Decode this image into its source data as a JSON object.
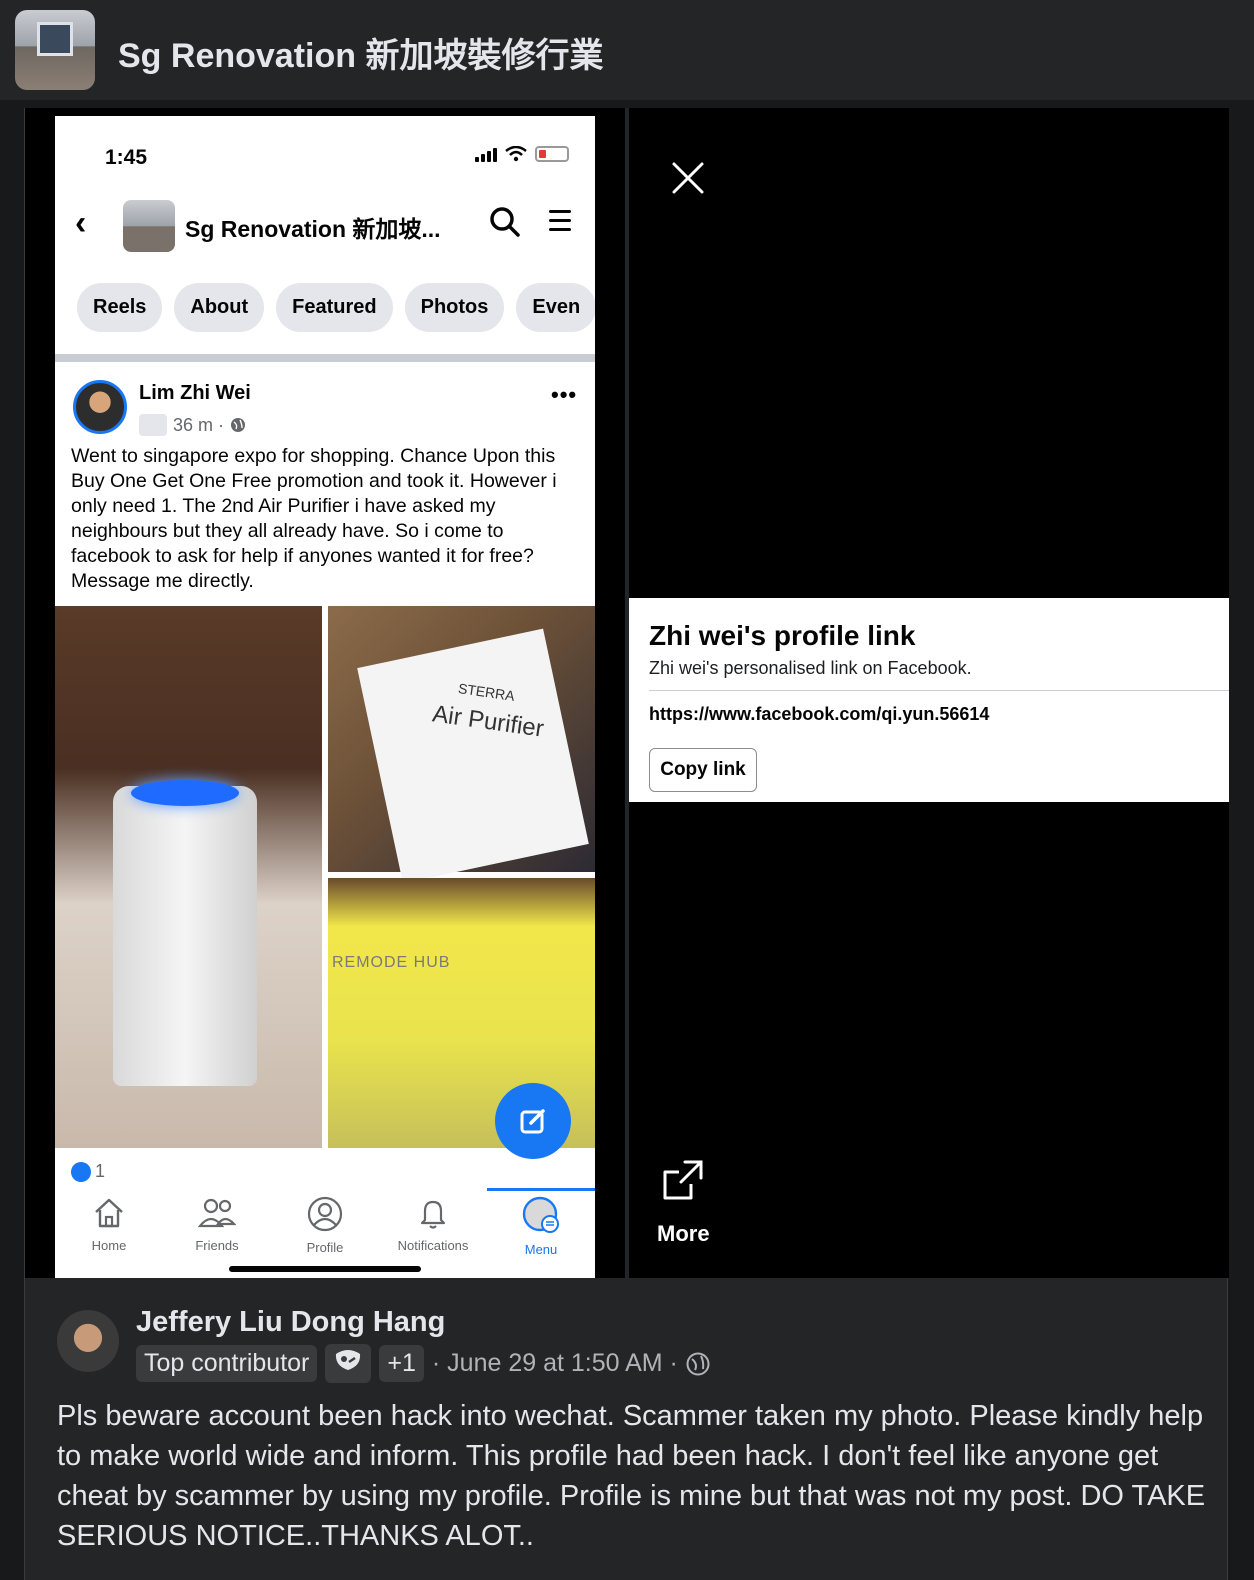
{
  "group": {
    "title": "Sg Renovation 新加坡裝修行業"
  },
  "phone": {
    "status_time": "1:45",
    "nav_title": "Sg Renovation 新加坡...",
    "chips": [
      "Reels",
      "About",
      "Featured",
      "Photos",
      "Even"
    ],
    "post": {
      "author": "Lim Zhi Wei",
      "time": "36 m ·",
      "text": "Went to singapore expo for shopping. Chance Upon this Buy One Get One Free promotion and took it. However i only need 1. The 2nd Air Purifier i have asked my neighbours but they all already have. So i come to facebook to ask for help if anyones wanted it for free? Message me directly.",
      "photo_texts": {
        "brand": "STERRA",
        "product": "Air Purifier",
        "store": "REMODE HUB"
      },
      "likes": "1"
    },
    "tabs": [
      "Home",
      "Friends",
      "Profile",
      "Notifications",
      "Menu"
    ],
    "active_tab": "Menu"
  },
  "profile_link": {
    "title": "Zhi wei's profile link",
    "subtitle": "Zhi wei's personalised link on Facebook.",
    "url": "https://www.facebook.com/qi.yun.56614",
    "copy_label": "Copy link",
    "more_label": "More"
  },
  "comment": {
    "author": "Jeffery Liu Dong Hang",
    "badge": "Top contributor",
    "extra": "+1",
    "time": "· June 29 at 1:50 AM ·",
    "text": "Pls beware account been hack into wechat. Scammer taken my photo. Please kindly help to make world wide and inform. This profile had been hack. I don't feel like anyone get cheat by scammer by using my profile. Profile is mine but that was not my post. DO TAKE SERIOUS NOTICE..THANKS ALOT.."
  },
  "colors": {
    "accent": "#1877f2",
    "bg": "#18191a",
    "card": "#242526"
  }
}
